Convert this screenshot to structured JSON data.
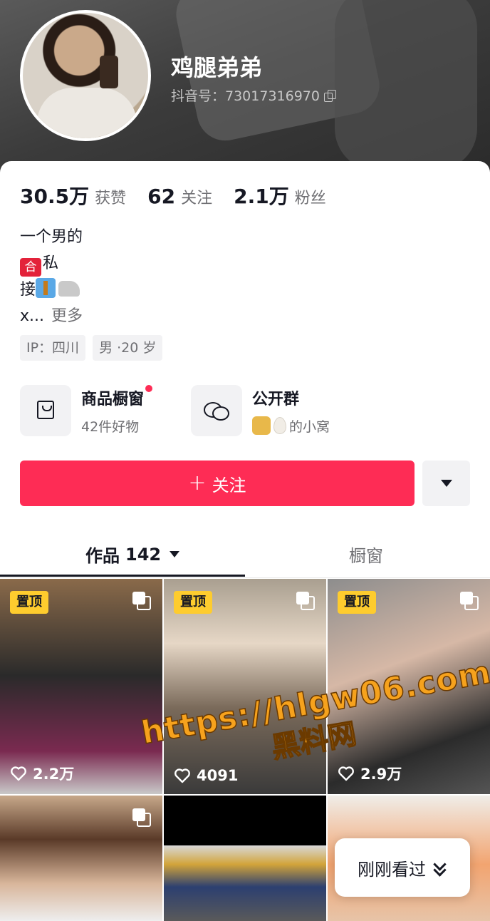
{
  "profile": {
    "username": "鸡腿弟弟",
    "douyin_id": "抖音号：73017316970"
  },
  "stats": [
    {
      "num": "30.5万",
      "label": "获赞"
    },
    {
      "num": "62",
      "label": "关注"
    },
    {
      "num": "2.1万",
      "label": "粉丝"
    }
  ],
  "bio": {
    "line1": "一个男的",
    "line2_emoji": "合",
    "line2_text": "私",
    "line3_text": "接",
    "line4_text": "x...",
    "more": "更多"
  },
  "tags": [
    "IP：四川",
    "男 ·20 岁"
  ],
  "entries": {
    "shop": {
      "title": "商品橱窗",
      "sub": "42件好物"
    },
    "group": {
      "title": "公开群",
      "sub": "的小窝"
    }
  },
  "actions": {
    "follow_plus": "+",
    "follow_label": "关注"
  },
  "tabs": {
    "works_label": "作品",
    "works_count": "142",
    "shop_label": "橱窗"
  },
  "videos": [
    {
      "pinned": "置顶",
      "likes": "2.2万"
    },
    {
      "pinned": "置顶",
      "likes": "4091"
    },
    {
      "pinned": "置顶",
      "likes": "2.9万"
    }
  ],
  "watermark": {
    "url": "https://hlgw06.com",
    "cn": "黑料网"
  },
  "floating": {
    "recent_label": "刚刚看过"
  },
  "colors": {
    "accent": "#fe2c55",
    "pin_badge": "#fecc2e"
  }
}
